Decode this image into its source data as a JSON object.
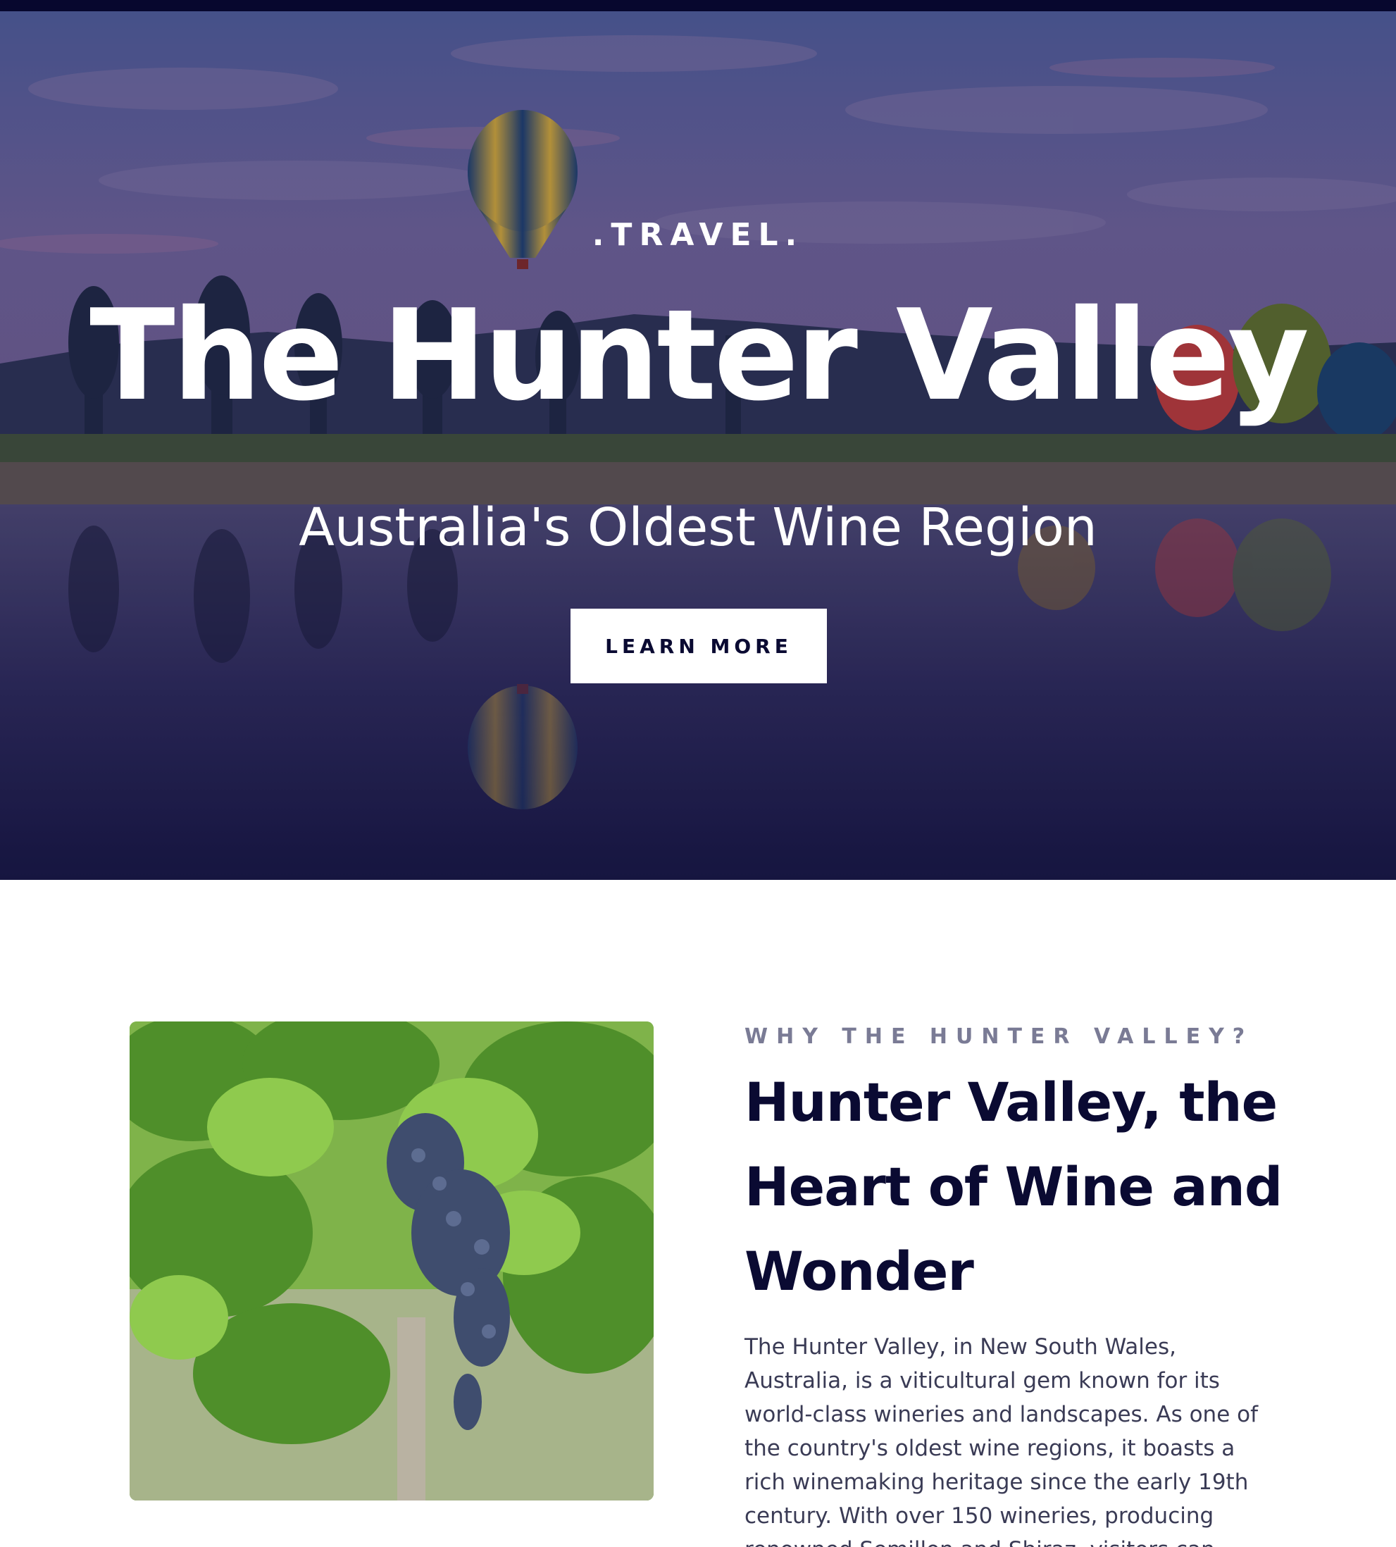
{
  "hero": {
    "tag": ".TRAVEL.",
    "title": "The Hunter Valley",
    "subtitle": "Australia's Oldest Wine Region",
    "button_label": "LEARN MORE"
  },
  "about": {
    "kicker": "WHY THE HUNTER VALLEY?",
    "heading": "Hunter Valley, the Heart of Wine and Wonder",
    "body": "The Hunter Valley, in New South Wales, Australia, is a viticultural gem known for its world-class wineries and landscapes. As one of the country's oldest wine regions, it boasts a rich winemaking heritage since the early 19th century. With over 150 wineries, producing renowned Semillon and Shiraz, visitors can"
  },
  "colors": {
    "navy": "#0a0a32",
    "topbar": "#07072e",
    "kicker": "#7a7b95",
    "body_text": "#3a3b55"
  },
  "images": {
    "hero": "hot-air-balloons-over-lake-photo",
    "about": "grape-vines-photo"
  }
}
